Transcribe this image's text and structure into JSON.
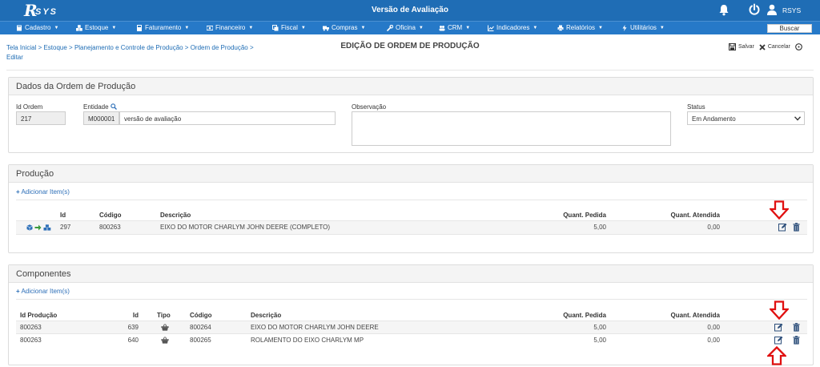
{
  "app": {
    "logo_letter": "R",
    "logo_text": "SYS",
    "window_title": "Versão de Avaliação",
    "username": "RSYS"
  },
  "menu": {
    "items": [
      {
        "label": "Cadastro"
      },
      {
        "label": "Estoque"
      },
      {
        "label": "Faturamento"
      },
      {
        "label": "Financeiro"
      },
      {
        "label": "Fiscal"
      },
      {
        "label": "Compras"
      },
      {
        "label": "Oficina"
      },
      {
        "label": "CRM"
      },
      {
        "label": "Indicadores"
      },
      {
        "label": "Relatórios"
      },
      {
        "label": "Utilitários"
      }
    ],
    "search_label": "Buscar"
  },
  "breadcrumb": {
    "line1": "Tela Inicial > Estoque > Planejamento e Controle de Produção > Ordem de Produção >",
    "line2": "Editar"
  },
  "page": {
    "title": "EDIÇÃO DE ORDEM DE PRODUÇÃO",
    "save_label": "Salvar",
    "cancel_label": "Cancelar"
  },
  "dados": {
    "heading": "Dados da Ordem de Produção",
    "id_label": "Id Ordem",
    "id_value": "217",
    "entidade_label": "Entidade",
    "entidade_code": "M000001",
    "entidade_name": "versão de avaliação",
    "obs_label": "Observação",
    "obs_value": "",
    "status_label": "Status",
    "status_value": "Em Andamento"
  },
  "producao": {
    "heading": "Produção",
    "add_label": "Adicionar Item(s)",
    "headers": {
      "id": "Id",
      "codigo": "Código",
      "descricao": "Descrição",
      "qpedida": "Quant. Pedida",
      "qatendida": "Quant. Atendida"
    },
    "rows": [
      {
        "id": "297",
        "codigo": "800263",
        "descricao": "EIXO DO MOTOR CHARLYM JOHN DEERE (COMPLETO)",
        "qpedida": "5,00",
        "qatendida": "0,00"
      }
    ]
  },
  "componentes": {
    "heading": "Componentes",
    "add_label": "Adicionar Item(s)",
    "headers": {
      "idprod": "Id Produção",
      "id": "Id",
      "tipo": "Tipo",
      "codigo": "Código",
      "descricao": "Descrição",
      "qpedida": "Quant. Pedida",
      "qatendida": "Quant. Atendida"
    },
    "rows": [
      {
        "idprod": "800263",
        "id": "639",
        "codigo": "800264",
        "descricao": "EIXO DO MOTOR CHARLYM JOHN DEERE",
        "qpedida": "5,00",
        "qatendida": "0,00"
      },
      {
        "idprod": "800263",
        "id": "640",
        "codigo": "800265",
        "descricao": "ROLAMENTO DO EIXO CHARLYM MP",
        "qpedida": "5,00",
        "qatendida": "0,00"
      }
    ]
  },
  "colors": {
    "topbar": "#1f6db5",
    "menubar": "#2679c8",
    "link": "#2d6fb8",
    "annotation_arrow": "#e01010"
  },
  "icons": {
    "notification": "bell-icon",
    "logout": "power-icon",
    "user": "user-icon",
    "save": "save-icon",
    "cancel": "close-icon",
    "help": "help-icon",
    "edit": "edit-icon",
    "delete": "trash-icon",
    "tipo": "basket-icon"
  }
}
